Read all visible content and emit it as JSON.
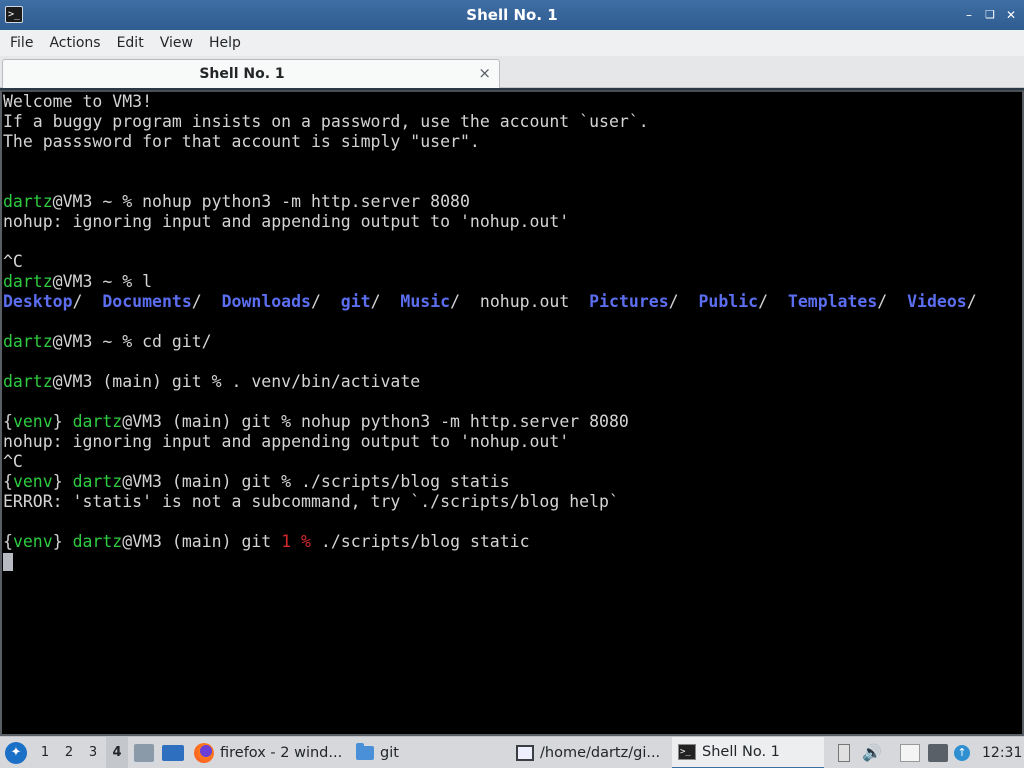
{
  "window": {
    "title": "Shell No. 1",
    "app_icon_glyph": ">_",
    "minimize_glyph": "–",
    "restore_glyph": "❑",
    "close_glyph": "✕"
  },
  "menubar": {
    "items": [
      "File",
      "Actions",
      "Edit",
      "View",
      "Help"
    ]
  },
  "tabs": [
    {
      "label": "Shell No. 1",
      "close_glyph": "×"
    }
  ],
  "terminal": {
    "lines": [
      [
        {
          "t": "Welcome to VM3!"
        }
      ],
      [
        {
          "t": "If a buggy program insists on a password, use the account `user`."
        }
      ],
      [
        {
          "t": "The passsword for that account is simply \"user\"."
        }
      ],
      [
        {
          "t": ""
        }
      ],
      [
        {
          "t": ""
        }
      ],
      [
        {
          "t": "dartz",
          "c": "user"
        },
        {
          "t": "@VM3 ~ % nohup python3 -m http.server 8080"
        }
      ],
      [
        {
          "t": "nohup: ignoring input and appending output to 'nohup.out'"
        }
      ],
      [
        {
          "t": ""
        }
      ],
      [
        {
          "t": "^C"
        }
      ],
      [
        {
          "t": "dartz",
          "c": "user"
        },
        {
          "t": "@VM3 ~ % l"
        }
      ],
      [
        {
          "t": "Desktop",
          "c": "dir"
        },
        {
          "t": "/  "
        },
        {
          "t": "Documents",
          "c": "dir"
        },
        {
          "t": "/  "
        },
        {
          "t": "Downloads",
          "c": "dir"
        },
        {
          "t": "/  "
        },
        {
          "t": "git",
          "c": "dir"
        },
        {
          "t": "/  "
        },
        {
          "t": "Music",
          "c": "dir"
        },
        {
          "t": "/  nohup.out  "
        },
        {
          "t": "Pictures",
          "c": "dir"
        },
        {
          "t": "/  "
        },
        {
          "t": "Public",
          "c": "dir"
        },
        {
          "t": "/  "
        },
        {
          "t": "Templates",
          "c": "dir"
        },
        {
          "t": "/  "
        },
        {
          "t": "Videos",
          "c": "dir"
        },
        {
          "t": "/"
        }
      ],
      [
        {
          "t": ""
        }
      ],
      [
        {
          "t": "dartz",
          "c": "user"
        },
        {
          "t": "@VM3 ~ % cd git/"
        }
      ],
      [
        {
          "t": ""
        }
      ],
      [
        {
          "t": "dartz",
          "c": "user"
        },
        {
          "t": "@VM3 (main) git % . venv/bin/activate"
        }
      ],
      [
        {
          "t": ""
        }
      ],
      [
        {
          "t": "{"
        },
        {
          "t": "venv",
          "c": "user"
        },
        {
          "t": "} "
        },
        {
          "t": "dartz",
          "c": "user"
        },
        {
          "t": "@VM3 (main) git % nohup python3 -m http.server 8080"
        }
      ],
      [
        {
          "t": "nohup: ignoring input and appending output to 'nohup.out'"
        }
      ],
      [
        {
          "t": "^C"
        }
      ],
      [
        {
          "t": "{"
        },
        {
          "t": "venv",
          "c": "user"
        },
        {
          "t": "} "
        },
        {
          "t": "dartz",
          "c": "user"
        },
        {
          "t": "@VM3 (main) git % ./scripts/blog statis"
        }
      ],
      [
        {
          "t": "ERROR: 'statis' is not a subcommand, try `./scripts/blog help`"
        }
      ],
      [
        {
          "t": ""
        }
      ],
      [
        {
          "t": "{"
        },
        {
          "t": "venv",
          "c": "user"
        },
        {
          "t": "} "
        },
        {
          "t": "dartz",
          "c": "user"
        },
        {
          "t": "@VM3 (main) git "
        },
        {
          "t": "1 %",
          "c": "err"
        },
        {
          "t": " ./scripts/blog static"
        }
      ]
    ]
  },
  "taskbar": {
    "workspaces": [
      "1",
      "2",
      "3",
      "4"
    ],
    "active_workspace": "4",
    "tasks": [
      {
        "label": "firefox - 2 wind...",
        "icon": "firefox-icon"
      },
      {
        "label": "git",
        "icon": "folder-icon"
      },
      {
        "label": "/home/dartz/gi...",
        "icon": "text-editor-icon"
      },
      {
        "label": "Shell No. 1",
        "icon": "terminal-icon",
        "active": true
      }
    ],
    "clock": "12:31",
    "colors": {
      "accent": "#3f6ea4",
      "user": "#2ecc40",
      "dir": "#5c6ef0",
      "error": "#d42a2a"
    }
  }
}
